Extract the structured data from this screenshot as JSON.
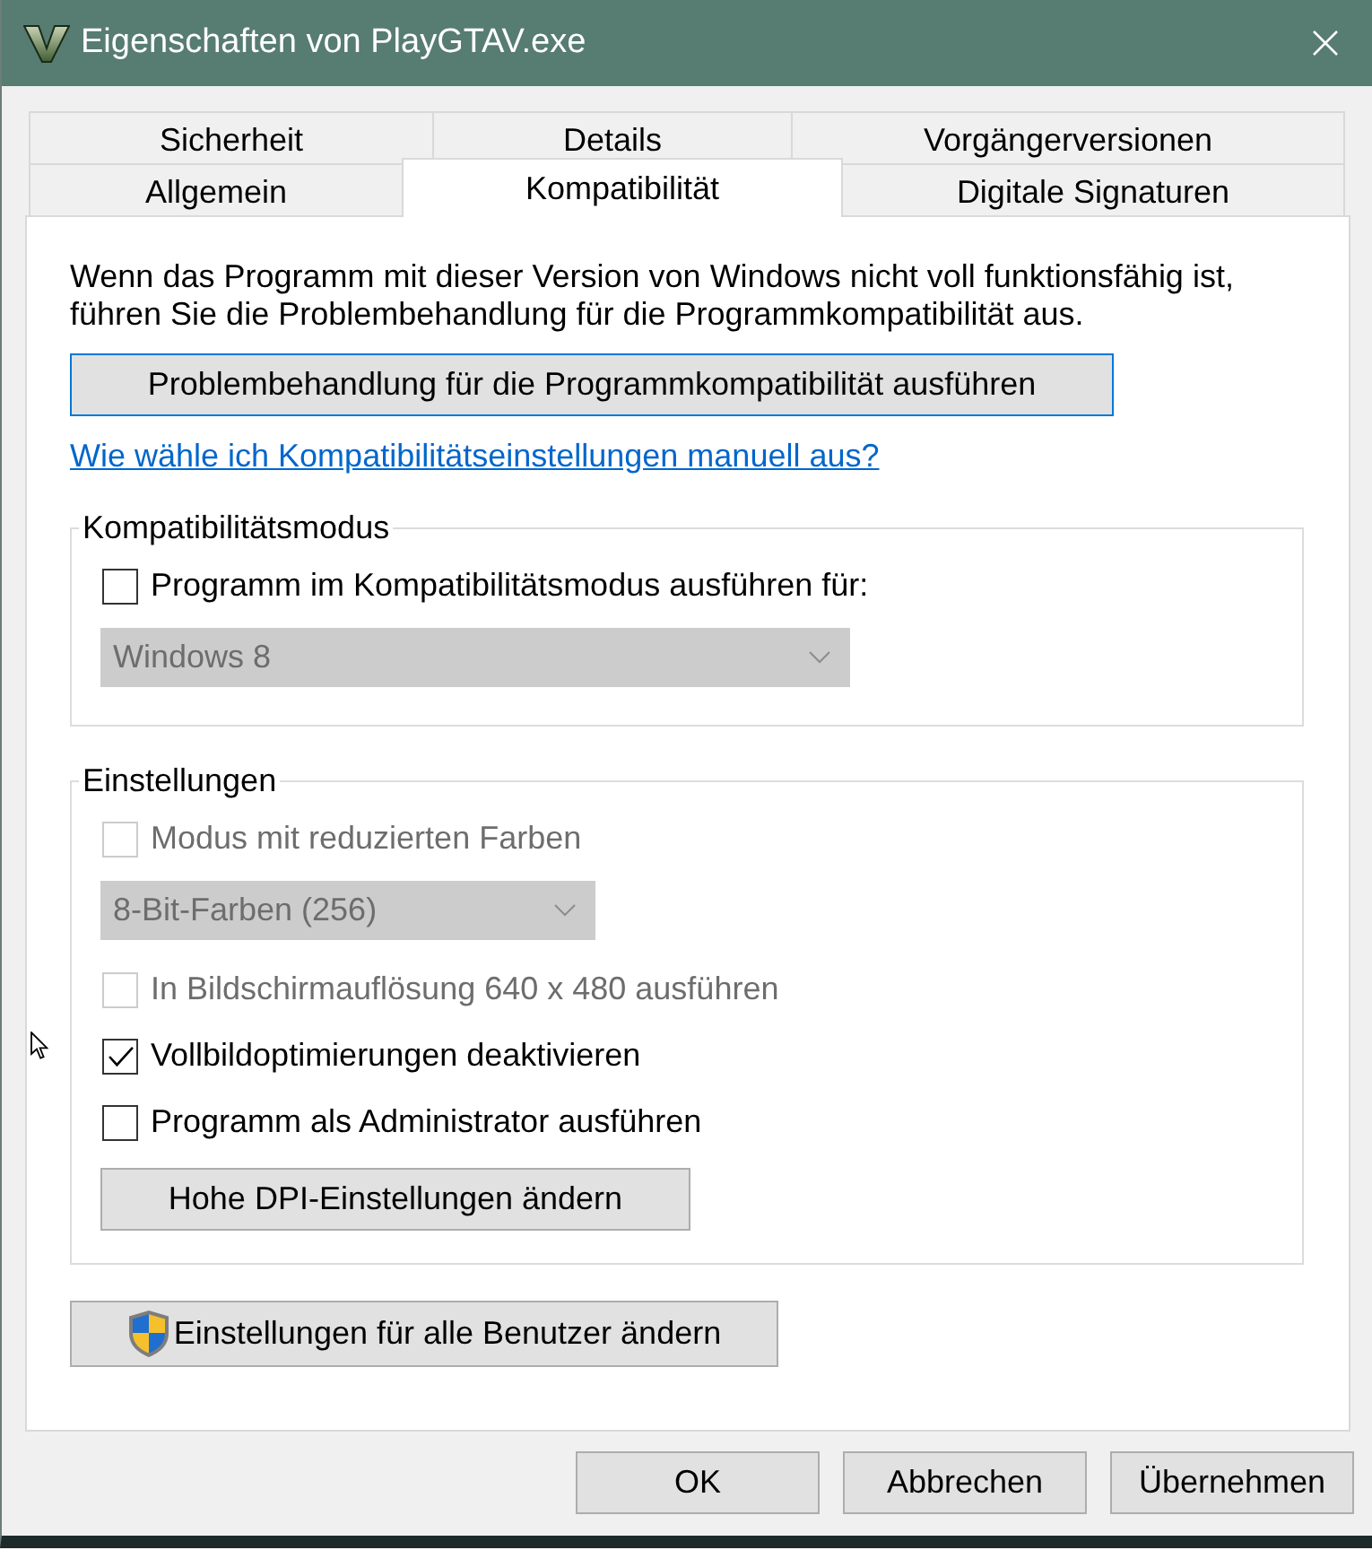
{
  "window": {
    "title": "Eigenschaften von PlayGTAV.exe"
  },
  "tab_rows": [
    [
      {
        "label": "Sicherheit",
        "selected": false
      },
      {
        "label": "Details",
        "selected": false
      },
      {
        "label": "Vorgängerversionen",
        "selected": false
      }
    ],
    [
      {
        "label": "Allgemein",
        "selected": false
      },
      {
        "label": "Kompatibilität",
        "selected": true
      },
      {
        "label": "Digitale Signaturen",
        "selected": false
      }
    ]
  ],
  "intro": "Wenn das Programm mit dieser Version von Windows nicht voll funktionsfähig ist, führen Sie die Problembehandlung für die Programmkompatibilität aus.",
  "troubleshoot_button": {
    "label": "Problembehandlung für die Programmkompatibilität ausführen",
    "focused": true
  },
  "help_link": "Wie wähle ich Kompatibilitätseinstellungen manuell aus?",
  "groups": [
    {
      "title": "Kompatibilitätsmodus",
      "items": [
        {
          "kind": "checkbox",
          "label": "Programm im Kompatibilitätsmodus ausführen für:",
          "checked": false,
          "disabled": false
        },
        {
          "kind": "dropdown",
          "value": "Windows 8",
          "disabled": true
        }
      ]
    },
    {
      "title": "Einstellungen",
      "items": [
        {
          "kind": "checkbox",
          "label": "Modus mit reduzierten Farben",
          "checked": false,
          "disabled": true
        },
        {
          "kind": "dropdown",
          "value": "8-Bit-Farben (256)",
          "disabled": true
        },
        {
          "kind": "checkbox",
          "label": "In Bildschirmauflösung 640 x 480 ausführen",
          "checked": false,
          "disabled": true
        },
        {
          "kind": "checkbox",
          "label": "Vollbildoptimierungen deaktivieren",
          "checked": true,
          "disabled": false
        },
        {
          "kind": "checkbox",
          "label": "Programm als Administrator ausführen",
          "checked": false,
          "disabled": false
        },
        {
          "kind": "button",
          "label": "Hohe DPI-Einstellungen ändern"
        }
      ]
    }
  ],
  "all_users_button": {
    "label": "Einstellungen für alle Benutzer ändern"
  },
  "dialog_buttons": [
    {
      "label": "OK"
    },
    {
      "label": "Abbrechen"
    },
    {
      "label": "Übernehmen"
    }
  ]
}
